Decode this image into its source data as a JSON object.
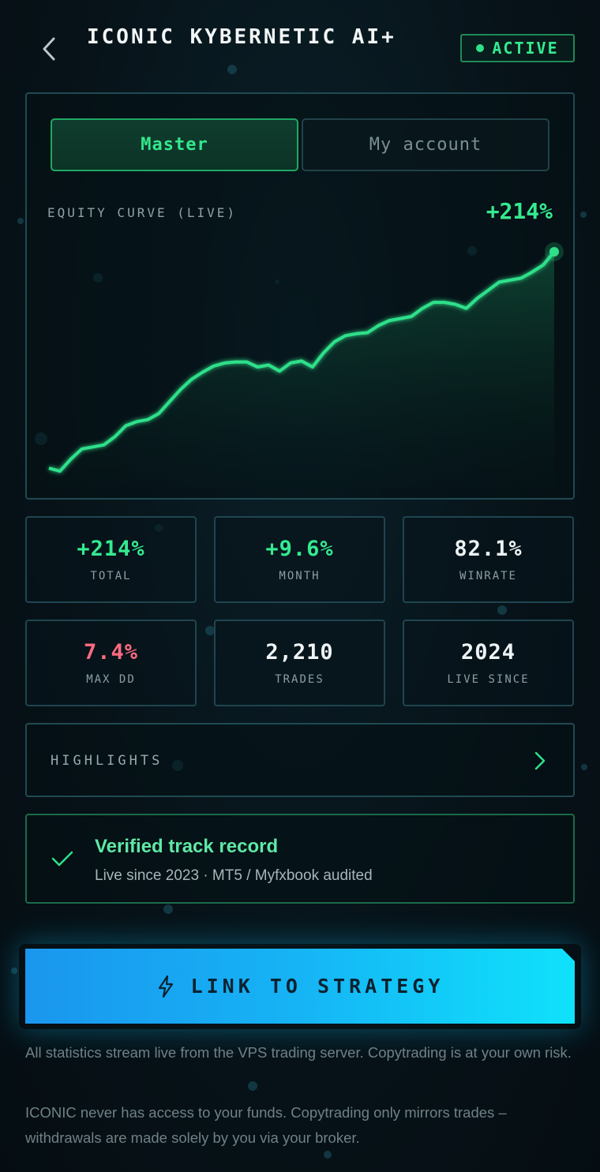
{
  "header": {
    "back_icon": "chevron-left-icon",
    "title": "ICONIC KYBERNETIC AI+",
    "status_badge": "ACTIVE",
    "status_color": "#35ea90"
  },
  "tabs": [
    {
      "label": "Master",
      "selected": true
    },
    {
      "label": "My account",
      "selected": false
    }
  ],
  "chart_data": {
    "type": "area",
    "title": "EQUITY CURVE (LIVE)",
    "total_label": "+214%",
    "color": "#2fe08a",
    "y": [
      0,
      -3,
      9,
      19,
      21,
      23,
      31,
      42,
      46,
      48,
      54,
      66,
      78,
      88,
      95,
      101,
      104,
      105,
      105,
      100,
      102,
      96,
      104,
      106,
      100,
      114,
      125,
      131,
      133,
      134,
      141,
      146,
      148,
      150,
      158,
      164,
      164,
      162,
      158,
      168,
      176,
      184,
      186,
      188,
      194,
      201,
      214
    ]
  },
  "stats": [
    {
      "value": "+214%",
      "label": "TOTAL",
      "color": "#35ea90"
    },
    {
      "value": "+9.6%",
      "label": "MONTH",
      "color": "#35ea90"
    },
    {
      "value": "82.1%",
      "label": "WINRATE",
      "color": "#eef4f5"
    },
    {
      "value": "7.4%",
      "label": "MAX DD",
      "color": "#ff6b80"
    },
    {
      "value": "2,210",
      "label": "TRADES",
      "color": "#eef4f5"
    },
    {
      "value": "2024",
      "label": "LIVE SINCE",
      "color": "#eef4f5"
    }
  ],
  "highlights": {
    "label": "HIGHLIGHTS",
    "icon": "chevron-right-icon"
  },
  "verified": {
    "icon": "check-icon",
    "title": "Verified track record",
    "subtitle": "Live since 2023 · MT5 / Myfxbook audited"
  },
  "cta": {
    "icon": "lightning-icon",
    "label": "LINK TO STRATEGY"
  },
  "notes": [
    "All statistics stream live from the VPS trading server. Copytrading is at your own risk.",
    "ICONIC never has access to your funds. Copytrading only mirrors trades – withdrawals are made solely by you via your broker."
  ]
}
